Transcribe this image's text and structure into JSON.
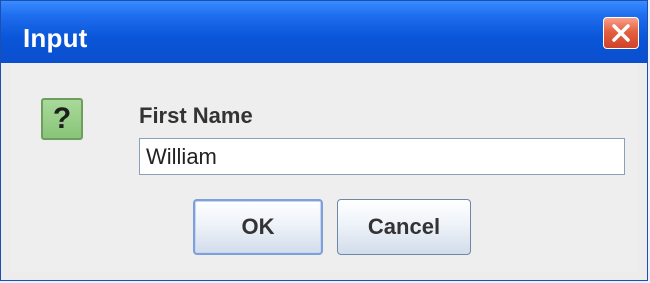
{
  "window": {
    "title": "Input",
    "close_icon": "close-icon"
  },
  "dialog": {
    "icon": "question-icon",
    "icon_glyph": "?",
    "label": "First Name",
    "input_value": "William"
  },
  "buttons": {
    "ok": "OK",
    "cancel": "Cancel"
  },
  "colors": {
    "titlebar": "#0a55d8",
    "close": "#e4603f",
    "question_bg": "#88c578"
  }
}
